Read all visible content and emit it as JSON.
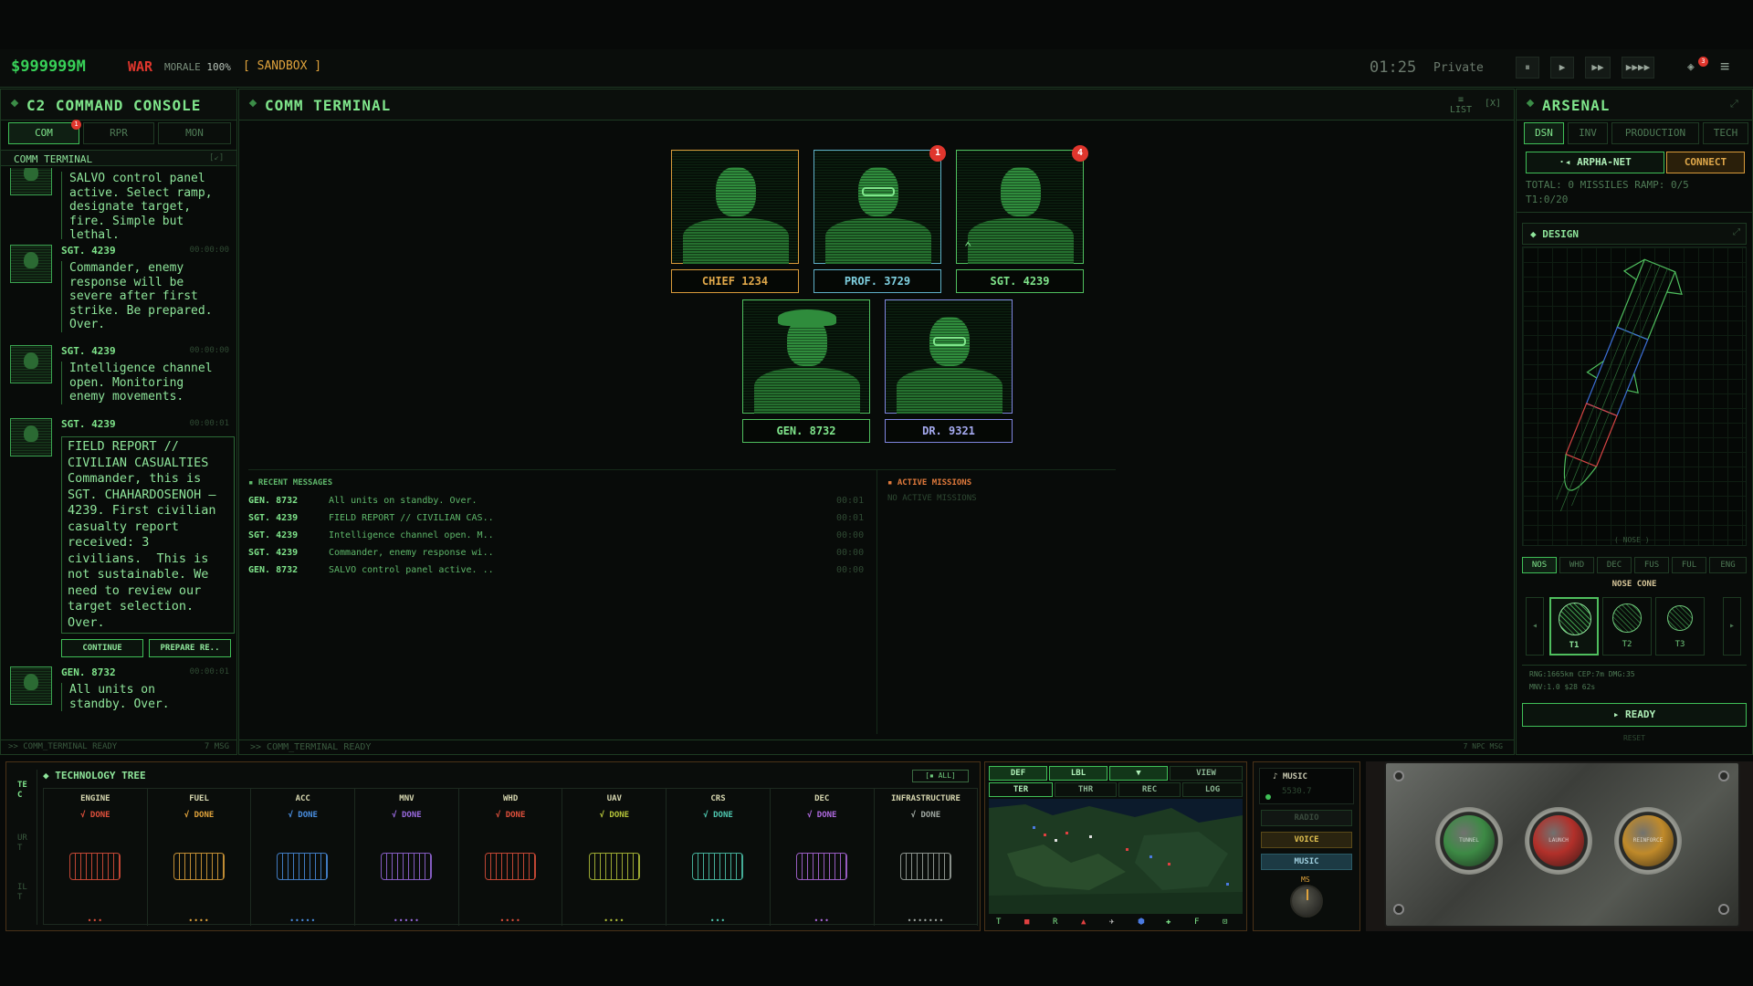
{
  "topbar": {
    "money": "$999999M",
    "war": "WAR",
    "morale_label": "MORALE",
    "morale_value": "100%",
    "mode": "[ SANDBOX ]",
    "clock": "01:25",
    "rank": "Private",
    "controls": [
      "⏸",
      "▶",
      "▶▶",
      "▶▶▶▶"
    ],
    "notif_count": "3",
    "menu_icon": "≡"
  },
  "left": {
    "title": "C2 COMMAND CONSOLE",
    "tabs": [
      "COM",
      "RPR",
      "MON"
    ],
    "tab_badge": "1",
    "subheader": "COMM TERMINAL",
    "subheader_right": "[↙]",
    "messages": [
      {
        "name": "",
        "time": "",
        "body": "SALVO control panel\nactive. Select ramp,\ndesignate target,\nfire. Simple but\nlethal."
      },
      {
        "name": "SGT. 4239",
        "time": "00:00:00",
        "body": "Commander, enemy\nresponse will be\nsevere after first\nstrike. Be prepared.\nOver."
      },
      {
        "name": "SGT. 4239",
        "time": "00:00:00",
        "body": "Intelligence channel\nopen. Monitoring\nenemy movements."
      },
      {
        "name": "SGT. 4239",
        "time": "00:00:01",
        "body": "FIELD REPORT //\nCIVILIAN CASUALTIES\nCommander, this is\nSGT. CHAHARDOSENOH —\n4239. First civilian\ncasualty report\nreceived: 3\ncivilians.  This is\nnot sustainable. We\nneed to review our\ntarget selection.\nOver."
      },
      {
        "name": "GEN. 8732",
        "time": "00:00:01",
        "body": "All units on\nstandby. Over."
      }
    ],
    "btn_continue": "CONTINUE",
    "btn_prepare": "PREPARE RE..",
    "footer": ">> COMM_TERMINAL READY",
    "footer_right": "7 MSG"
  },
  "center": {
    "title": "COMM TERMINAL",
    "list_label": "LIST",
    "close_label": "[X]",
    "portraits": [
      {
        "label": "CHIEF 1234",
        "color": "#d99b3a",
        "badge": ""
      },
      {
        "label": "PROF. 3729",
        "color": "#5fb0c8",
        "badge": "1"
      },
      {
        "label": "SGT. 4239",
        "color": "#4fbf5e",
        "badge": "4"
      },
      {
        "label": "GEN. 8732",
        "color": "#4fbf5e",
        "badge": ""
      },
      {
        "label": "DR. 9321",
        "color": "#7f86e0",
        "badge": ""
      }
    ],
    "recent_title": "RECENT MESSAGES",
    "recent": [
      {
        "name": "GEN. 8732",
        "text": "All units on standby. Over.",
        "time": "00:01"
      },
      {
        "name": "SGT. 4239",
        "text": "FIELD REPORT // CIVILIAN CAS..",
        "time": "00:01"
      },
      {
        "name": "SGT. 4239",
        "text": "Intelligence channel open. M..",
        "time": "00:00"
      },
      {
        "name": "SGT. 4239",
        "text": "Commander, enemy response wi..",
        "time": "00:00"
      },
      {
        "name": "GEN. 8732",
        "text": "SALVO control panel active. ..",
        "time": "00:00"
      }
    ],
    "missions_title": "ACTIVE MISSIONS",
    "missions_empty": "NO ACTIVE MISSIONS",
    "footer": ">> COMM_TERMINAL READY",
    "footer_right": "7 NPC MSG"
  },
  "right": {
    "title": "ARSENAL",
    "tabs": [
      "DSN",
      "INV",
      "PRODUCTION",
      "TECH"
    ],
    "net_label": "·◂ ARPHA-NET",
    "connect": "CONNECT",
    "totals": "TOTAL: 0 MISSILES RAMP: 0/5",
    "tier": "T1:0/20",
    "design_title": "DESIGN",
    "nose_caption": "( NOSE )",
    "part_tabs": [
      "NOS",
      "WHD",
      "DEC",
      "FUS",
      "FUL",
      "ENG"
    ],
    "part_title": "NOSE CONE",
    "tiers": [
      "T1",
      "T2",
      "T3"
    ],
    "stats1": "RNG:1665km CEP:7m DMG:35",
    "stats2": "MNV:1.0 $28 62s",
    "ready": "▸ READY",
    "reset": "RESET"
  },
  "tech": {
    "side_tabs": [
      "TEC",
      "URT",
      "ILT"
    ],
    "title": "TECHNOLOGY TREE",
    "all_label": "[▪ ALL]",
    "columns": [
      {
        "name": "ENGINE",
        "status": "√ DONE",
        "color": "#e0503c",
        "dots": "•••"
      },
      {
        "name": "FUEL",
        "status": "√ DONE",
        "color": "#e0a33c",
        "dots": "••••"
      },
      {
        "name": "ACC",
        "status": "√ DONE",
        "color": "#4a8ee0",
        "dots": "•••••"
      },
      {
        "name": "MNV",
        "status": "√ DONE",
        "color": "#9a6ae0",
        "dots": "•••••"
      },
      {
        "name": "WHD",
        "status": "√ DONE",
        "color": "#e0503c",
        "dots": "••••"
      },
      {
        "name": "UAV",
        "status": "√ DONE",
        "color": "#b5c43a",
        "dots": "••••"
      },
      {
        "name": "CRS",
        "status": "√ DONE",
        "color": "#4fc8b0",
        "dots": "•••"
      },
      {
        "name": "DEC",
        "status": "√ DONE",
        "color": "#b06ae0",
        "dots": "•••"
      },
      {
        "name": "INFRASTRUCTURE",
        "status": "√ DONE",
        "color": "#a0a8a2",
        "dots": "•••••••"
      }
    ]
  },
  "map": {
    "tabs_row1": [
      "DEF",
      "LBL",
      "▼",
      "VIEW"
    ],
    "tabs_row2": [
      "TER",
      "THR",
      "REC",
      "LOG"
    ],
    "legend": [
      "T",
      "■",
      "R",
      "▲",
      "✈",
      "⬢",
      "✚",
      "F",
      "⊡"
    ]
  },
  "audio": {
    "title": "♪ MUSIC",
    "track": "5530.7",
    "radio": "RADIO",
    "voice": "VOICE",
    "music": "MUSIC",
    "knob_label": "MS"
  },
  "console": {
    "buttons": [
      {
        "label": "TUNNEL",
        "color": "#3d8a45"
      },
      {
        "label": "LAUNCH",
        "color": "#b2302a"
      },
      {
        "label": "REINFORCE",
        "color": "#c08a2a"
      }
    ]
  }
}
